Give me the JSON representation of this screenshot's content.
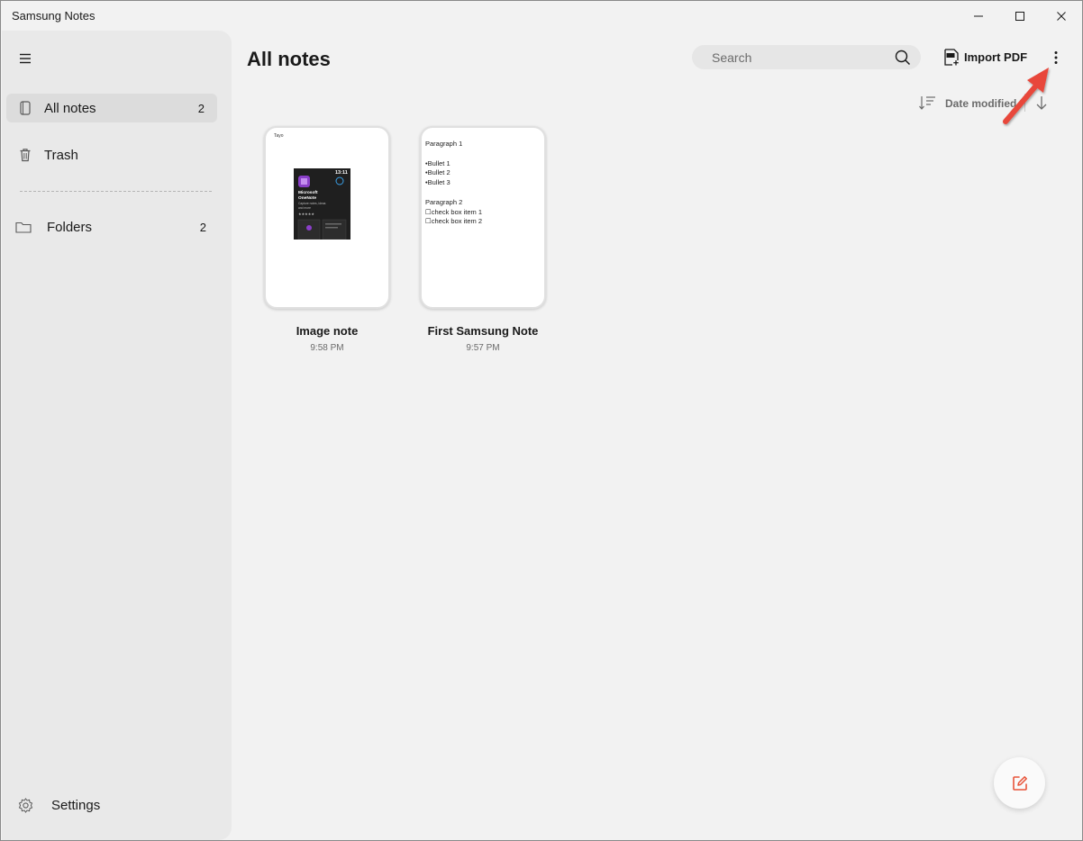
{
  "window": {
    "title": "Samsung Notes"
  },
  "sidebar": {
    "items": [
      {
        "label": "All notes",
        "count": "2",
        "icon": "notebook-icon",
        "active": true
      },
      {
        "label": "Trash",
        "count": "",
        "icon": "trash-icon"
      },
      {
        "label": "Folders",
        "count": "2",
        "icon": "folder-icon"
      }
    ],
    "settings_label": "Settings"
  },
  "header": {
    "title": "All notes",
    "search_placeholder": "Search",
    "import_label": "Import PDF"
  },
  "sort": {
    "label": "Date modified"
  },
  "notes": [
    {
      "title": "Image note",
      "time": "9:58 PM",
      "thumb_label": "Tayo",
      "image_app_name": "Microsoft OneNote",
      "image_clock": "13:11",
      "image_caption": "Capture notes, ideas and more"
    },
    {
      "title": "First Samsung Note",
      "time": "9:57 PM",
      "preview_lines": [
        "Paragraph 1",
        "",
        "•Bullet 1",
        "•Bullet 2",
        "•Bullet 3",
        "",
        "Paragraph 2",
        "☐check box item 1",
        "☐check box item 2"
      ]
    }
  ],
  "colors": {
    "accent": "#e8543a",
    "annotation_arrow": "#e8473b",
    "sidebar_bg": "#e9e9e9",
    "app_bg": "#f2f2f2"
  }
}
